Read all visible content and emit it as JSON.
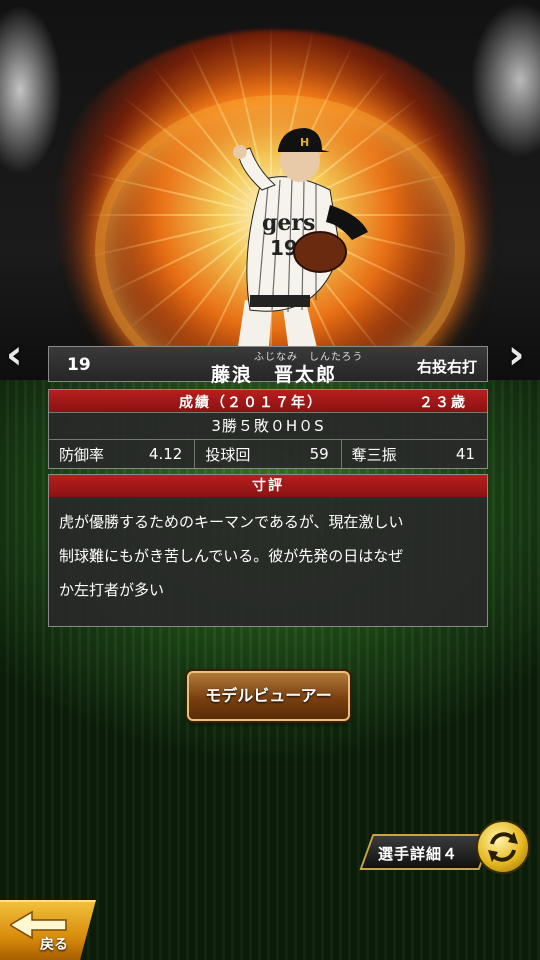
{
  "player": {
    "number": "19",
    "furigana": "ふじなみ　しんたろう",
    "name": "藤浪　晋太郎",
    "throws_bats": "右投右打"
  },
  "record": {
    "header": "成績（２０１７年）",
    "age": "２３歳",
    "summary": "3勝５敗０H０S",
    "stats": [
      {
        "label": "防御率",
        "value": "4.12"
      },
      {
        "label": "投球回",
        "value": "59"
      },
      {
        "label": "奪三振",
        "value": "41"
      }
    ]
  },
  "comment": {
    "header": "寸評",
    "lines": [
      "虎が優勝するためのキーマンであるが、現在激しい",
      "制球難にもがき苦しんでいる。彼が先発の日はなぜ",
      "か左打者が多い"
    ]
  },
  "buttons": {
    "model_viewer": "モデルビューアー",
    "player_detail": "選手詳細４",
    "back": "戻る"
  },
  "icons": {
    "prev": "chevron-left-icon",
    "next": "chevron-right-icon",
    "cycle": "refresh-icon"
  },
  "colors": {
    "header_red": "#b81e1e",
    "button_gold": "#e8c27a"
  }
}
